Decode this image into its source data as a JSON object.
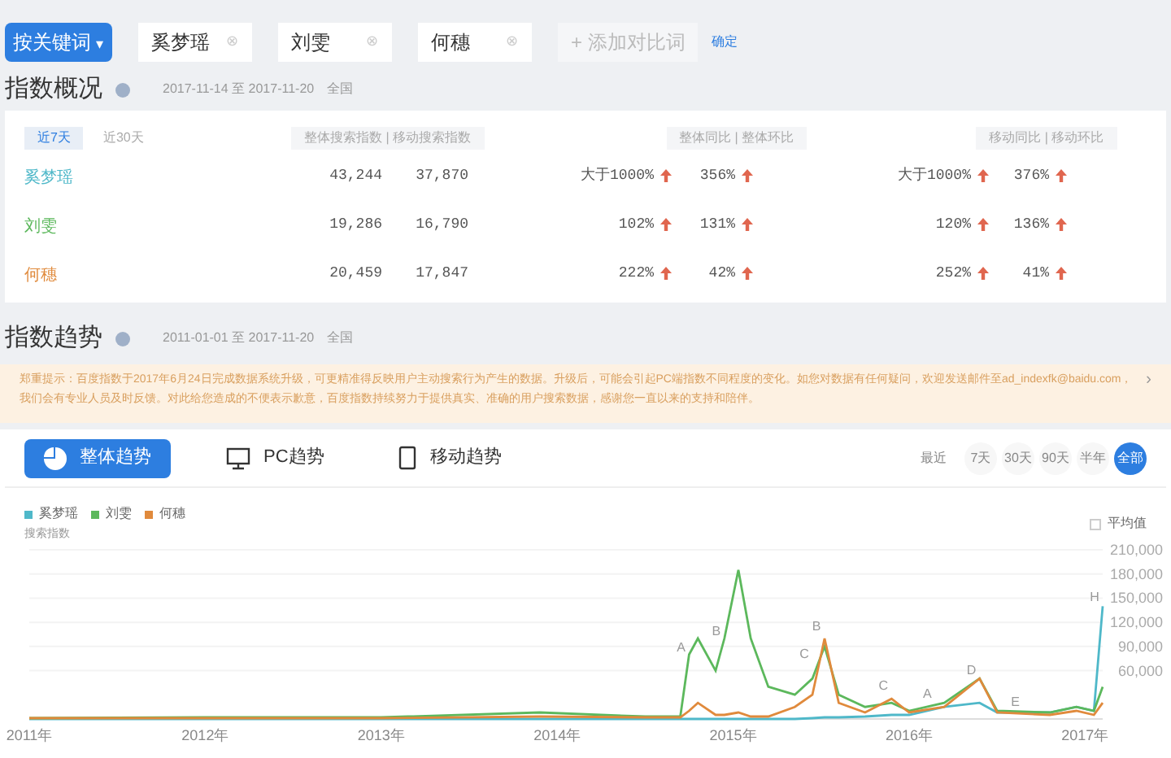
{
  "toolbar": {
    "mode_button": "按关键词",
    "mode_caret": "▾",
    "keywords": [
      {
        "text": "奚梦瑶",
        "clear": "⊗"
      },
      {
        "text": "刘雯",
        "clear": "⊗"
      },
      {
        "text": "何穗",
        "clear": "⊗"
      }
    ],
    "add_button": "+ 添加对比词",
    "confirm": "确定"
  },
  "overview": {
    "title": "指数概况",
    "range": "2017-11-14 至 2017-11-20",
    "region": "全国",
    "periods": [
      {
        "label": "近7天",
        "selected": true
      },
      {
        "label": "近30天",
        "selected": false
      }
    ],
    "headers": [
      {
        "left": "整体搜索指数",
        "separator": "|",
        "right": "移动搜索指数"
      },
      {
        "left": "整体同比",
        "separator": "|",
        "right": "整体环比"
      },
      {
        "left": "移动同比",
        "separator": "|",
        "right": "移动环比"
      }
    ],
    "rows": [
      {
        "name": "奚梦瑶",
        "color": "#4fb8c9",
        "overall": "43,244",
        "mobile": "37,870",
        "yoy": "大于1000%",
        "mom": "356%",
        "m_yoy": "大于1000%",
        "m_mom": "376%"
      },
      {
        "name": "刘雯",
        "color": "#5cb85c",
        "overall": "19,286",
        "mobile": "16,790",
        "yoy": "102%",
        "mom": "131%",
        "m_yoy": "120%",
        "m_mom": "136%"
      },
      {
        "name": "何穗",
        "color": "#e08a3c",
        "overall": "20,459",
        "mobile": "17,847",
        "yoy": "222%",
        "mom": "42%",
        "m_yoy": "252%",
        "m_mom": "41%"
      }
    ]
  },
  "trend": {
    "title": "指数趋势",
    "range": "2011-01-01 至 2017-11-20",
    "region": "全国",
    "notice": "郑重提示：百度指数于2017年6月24日完成数据系统升级，可更精准得反映用户主动搜索行为产生的数据。升级后，可能会引起PC端指数不同程度的变化。如您对数据有任何疑问，欢迎发送邮件至ad_indexfk@baidu.com，我们会有专业人员及时反馈。对此给您造成的不便表示歉意，百度指数持续努力于提供真实、准确的用户搜索数据，感谢您一直以来的支持和陪伴。",
    "notice_arrow": "›",
    "tabs": [
      {
        "label": "整体趋势",
        "kind": "overall",
        "selected": true
      },
      {
        "label": "PC趋势",
        "kind": "pc",
        "selected": false
      },
      {
        "label": "移动趋势",
        "kind": "mobile",
        "selected": false
      }
    ],
    "recent_label": "最近",
    "ranges": [
      {
        "label": "7天",
        "selected": false
      },
      {
        "label": "30天",
        "selected": false
      },
      {
        "label": "90天",
        "selected": false
      },
      {
        "label": "半年",
        "selected": false
      },
      {
        "label": "全部",
        "selected": true
      }
    ],
    "average": {
      "label": "平均值",
      "checked": false
    },
    "chart_data": {
      "type": "line",
      "ylabel": "搜索指数",
      "grid": true,
      "x": [
        2011,
        2012,
        2013,
        2013.9,
        2014.5,
        2014.7,
        2014.75,
        2014.8,
        2014.9,
        2014.95,
        2015.03,
        2015.1,
        2015.2,
        2015.35,
        2015.45,
        2015.52,
        2015.6,
        2015.75,
        2015.9,
        2016.0,
        2016.2,
        2016.4,
        2016.5,
        2016.8,
        2016.95,
        2017.05,
        2017.1
      ],
      "series": [
        {
          "name": "奚梦瑶",
          "color": "#4fb8c9",
          "values": [
            0,
            0,
            0,
            0,
            0,
            0,
            0,
            0,
            0,
            0,
            0,
            0,
            0,
            0,
            1000,
            2000,
            2000,
            3000,
            5000,
            5000,
            15000,
            20000,
            8000,
            8000,
            15000,
            10000,
            140000
          ]
        },
        {
          "name": "刘雯",
          "color": "#5cb85c",
          "values": [
            1000,
            2000,
            2000,
            8000,
            3000,
            3000,
            80000,
            100000,
            60000,
            100000,
            185000,
            100000,
            40000,
            30000,
            50000,
            90000,
            30000,
            15000,
            20000,
            10000,
            20000,
            50000,
            10000,
            8000,
            15000,
            10000,
            40000
          ]
        },
        {
          "name": "何穗",
          "color": "#e08a3c",
          "values": [
            1000,
            1000,
            1000,
            3000,
            2000,
            2000,
            10000,
            20000,
            5000,
            5000,
            8000,
            3000,
            3000,
            15000,
            30000,
            100000,
            20000,
            8000,
            25000,
            8000,
            15000,
            50000,
            8000,
            5000,
            10000,
            5000,
            20000
          ]
        }
      ],
      "xlim": [
        2011,
        2017.1
      ],
      "ylim": [
        0,
        210000
      ],
      "xticks": [
        {
          "value": 2011,
          "label": "2011年"
        },
        {
          "value": 2012,
          "label": "2012年"
        },
        {
          "value": 2013,
          "label": "2013年"
        },
        {
          "value": 2014,
          "label": "2014年"
        },
        {
          "value": 2015,
          "label": "2015年"
        },
        {
          "value": 2016,
          "label": "2016年"
        },
        {
          "value": 2017,
          "label": "2017年"
        }
      ],
      "yticks": [
        {
          "value": 60000,
          "label": "60,000"
        },
        {
          "value": 90000,
          "label": "90,000"
        },
        {
          "value": 120000,
          "label": "120,000"
        },
        {
          "value": 150000,
          "label": "150,000"
        },
        {
          "value": 180000,
          "label": "180,000"
        },
        {
          "value": 210000,
          "label": "210,000"
        }
      ],
      "annotations": [
        {
          "text": "A",
          "x": 2014.75,
          "y": 84000
        },
        {
          "text": "B",
          "x": 2014.95,
          "y": 104000
        },
        {
          "text": "C",
          "x": 2015.45,
          "y": 76000
        },
        {
          "text": "B",
          "x": 2015.52,
          "y": 110000
        },
        {
          "text": "C",
          "x": 2015.9,
          "y": 36000
        },
        {
          "text": "A",
          "x": 2016.15,
          "y": 26000
        },
        {
          "text": "D",
          "x": 2016.4,
          "y": 56000
        },
        {
          "text": "E",
          "x": 2016.65,
          "y": 16000
        },
        {
          "text": "H",
          "x": 2017.1,
          "y": 146000
        }
      ]
    }
  }
}
